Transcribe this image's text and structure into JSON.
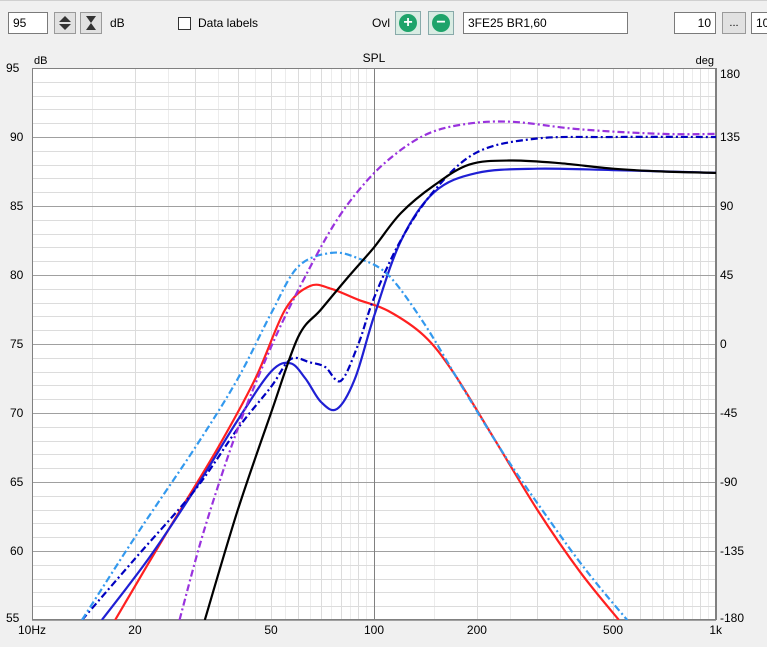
{
  "toolbar": {
    "level_value": "95",
    "level_unit": "dB",
    "data_labels_label": "Data labels",
    "overlay_label": "Ovl",
    "add_icon": "plus-circle-icon",
    "remove_icon": "minus-circle-icon",
    "overlay_name": "3FE25 BR1,60",
    "range_start": "10",
    "range_sep": "...",
    "range_end": "10"
  },
  "chart_data": {
    "type": "line",
    "title": "SPL",
    "ylabel": "dB",
    "y2label": "deg",
    "xscale": "log",
    "xlim": [
      10,
      1000
    ],
    "ylim": [
      55,
      95
    ],
    "y2lim": [
      -180,
      180
    ],
    "grid": true,
    "xticks": [
      "10Hz",
      "20",
      "50",
      "100",
      "200",
      "500",
      "1k"
    ],
    "xtick_values": [
      10,
      20,
      50,
      100,
      200,
      500,
      1000
    ],
    "yticks": [
      "95",
      "90",
      "85",
      "80",
      "75",
      "70",
      "65",
      "60",
      "55"
    ],
    "y2ticks": [
      "180",
      "135",
      "90",
      "45",
      "0",
      "-45",
      "-90",
      "-135",
      "-180"
    ],
    "series": [
      {
        "color": "#ff2020",
        "axis": "left",
        "dash": "solid",
        "x": [
          17.5,
          25,
          35,
          45,
          55,
          65,
          75,
          90,
          110,
          140,
          170,
          220,
          300,
          400,
          520
        ],
        "y": [
          55,
          61.5,
          67.5,
          72.5,
          77.5,
          79.2,
          79,
          78.2,
          77.4,
          75.6,
          73,
          68.5,
          63,
          58.5,
          55
        ]
      },
      {
        "color": "#1f1fd4",
        "axis": "left",
        "dash": "solid",
        "x": [
          16,
          22,
          30,
          40,
          50,
          57,
          63,
          70,
          78,
          88,
          100,
          120,
          150,
          200,
          300,
          500,
          1000
        ],
        "y": [
          55,
          59.5,
          64.5,
          69.5,
          73,
          73.6,
          72.5,
          70.8,
          70.3,
          72.5,
          77,
          82.5,
          86,
          87.4,
          87.7,
          87.6,
          87.4
        ]
      },
      {
        "color": "#0000c0",
        "axis": "right",
        "dash": "dashdot",
        "x": [
          14,
          20,
          30,
          40,
          50,
          57,
          65,
          72,
          80,
          90,
          100,
          120,
          150,
          200,
          300,
          500,
          1000
        ],
        "y": [
          -180,
          -140,
          -95,
          -55,
          -28,
          -10,
          -12,
          -15,
          -24,
          0,
          30,
          68,
          100,
          125,
          134,
          135,
          135
        ]
      },
      {
        "color": "#3399ee",
        "axis": "left",
        "dash": "dashdot",
        "x": [
          14,
          20,
          30,
          40,
          50,
          60,
          75,
          90,
          110,
          140,
          180,
          240,
          320,
          420,
          550
        ],
        "y": [
          55,
          61,
          67.5,
          72.5,
          77.2,
          80.6,
          81.6,
          81.2,
          80,
          76.5,
          72,
          67,
          62.5,
          58.5,
          55
        ]
      },
      {
        "color": "#9932dd",
        "axis": "right",
        "dash": "dashdot",
        "x": [
          27,
          32,
          40,
          50,
          60,
          75,
          90,
          110,
          140,
          180,
          250,
          400,
          700,
          1000
        ],
        "y": [
          -180,
          -120,
          -55,
          -2,
          35,
          75,
          100,
          120,
          136,
          143,
          145,
          140,
          137,
          137
        ]
      },
      {
        "color": "#000000",
        "axis": "left",
        "dash": "solid",
        "x": [
          32,
          40,
          50,
          60,
          70,
          85,
          100,
          120,
          150,
          190,
          250,
          350,
          500,
          700,
          1000
        ],
        "y": [
          55,
          63,
          70,
          75.5,
          77.5,
          80,
          82,
          84.5,
          86.5,
          88,
          88.3,
          88.1,
          87.7,
          87.5,
          87.4
        ]
      }
    ]
  }
}
